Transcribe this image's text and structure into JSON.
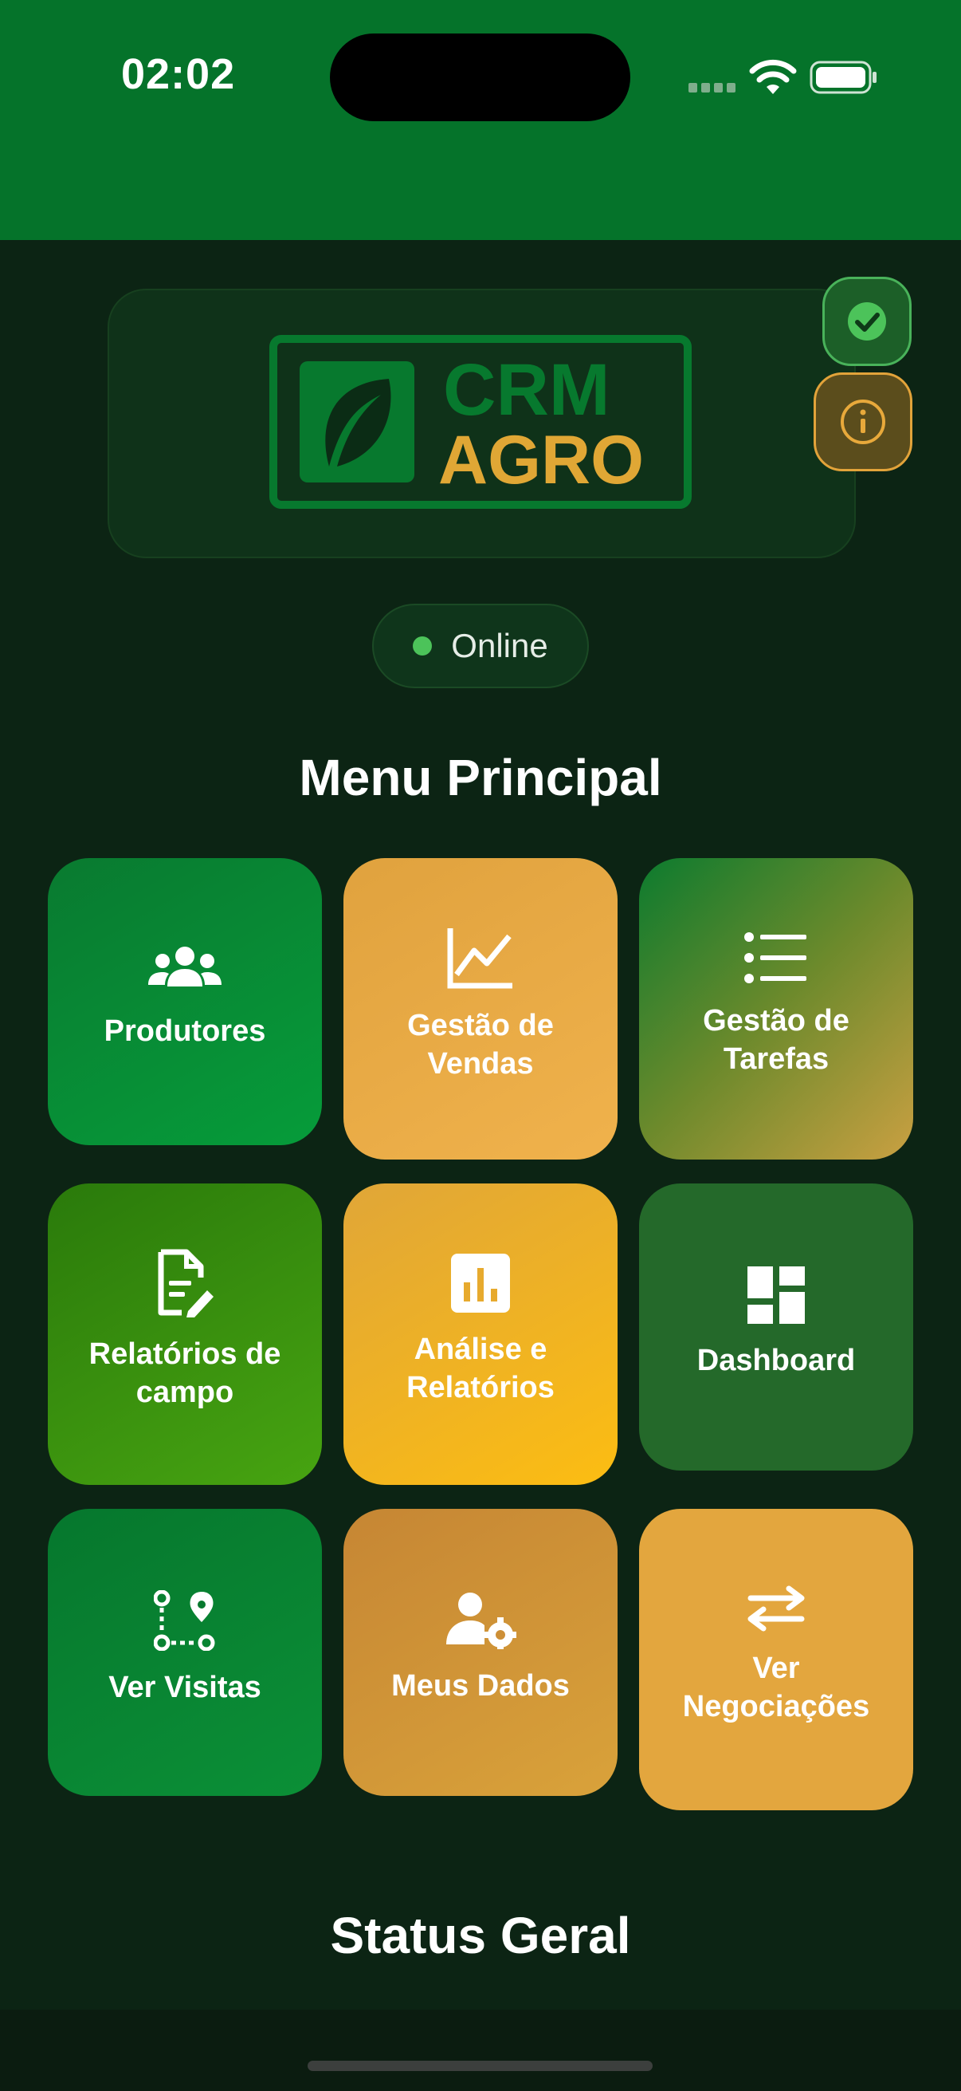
{
  "status_bar": {
    "time": "02:02"
  },
  "logo": {
    "line1": "CRM",
    "line2": "AGRO"
  },
  "connection": {
    "status": "Online"
  },
  "menu": {
    "title": "Menu Principal",
    "items": [
      {
        "label": "Produtores",
        "icon": "users-icon"
      },
      {
        "label": "Gestão de Vendas",
        "icon": "line-chart-icon"
      },
      {
        "label": "Gestão de Tarefas",
        "icon": "list-icon"
      },
      {
        "label": "Relatórios de campo",
        "icon": "document-edit-icon"
      },
      {
        "label": "Análise e Relatórios",
        "icon": "bar-chart-icon"
      },
      {
        "label": "Dashboard",
        "icon": "dashboard-icon"
      },
      {
        "label": "Ver Visitas",
        "icon": "route-icon"
      },
      {
        "label": "Meus Dados",
        "icon": "user-settings-icon"
      },
      {
        "label": "Ver Negociações",
        "icon": "swap-icon"
      }
    ]
  },
  "status_section": {
    "title": "Status Geral"
  },
  "colors": {
    "primary_green": "#05732a",
    "background": "#0c2414",
    "accent_orange": "#e3a63e",
    "online": "#4cc35a"
  }
}
